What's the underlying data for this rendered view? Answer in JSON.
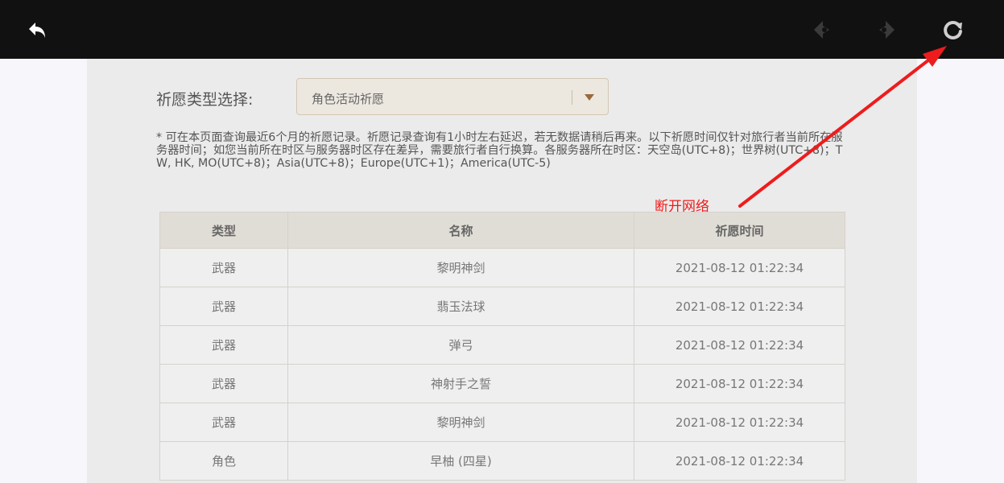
{
  "toolbar": {
    "icons": [
      "back-icon",
      "prev-page-icon",
      "next-page-icon",
      "refresh-icon"
    ]
  },
  "filter": {
    "label": "祈愿类型选择:",
    "selected": "角色活动祈愿"
  },
  "notice": "* 可在本页面查询最近6个月的祈愿记录。祈愿记录查询有1小时左右延迟，若无数据请稍后再来。以下祈愿时间仅针对旅行者当前所在服务器时间；如您当前所在时区与服务器时区存在差异，需要旅行者自行换算。各服务器所在时区：天空岛(UTC+8)；世界树(UTC+8)；TW, HK, MO(UTC+8)；Asia(UTC+8)；Europe(UTC+1)；America(UTC-5)",
  "annotation": {
    "text": "断开网络",
    "color": "#ee1c1c"
  },
  "table": {
    "headers": [
      "类型",
      "名称",
      "祈愿时间"
    ],
    "rows": [
      {
        "type": "武器",
        "name": "黎明神剑",
        "time": "2021-08-12 01:22:34"
      },
      {
        "type": "武器",
        "name": "翡玉法球",
        "time": "2021-08-12 01:22:34"
      },
      {
        "type": "武器",
        "name": "弹弓",
        "time": "2021-08-12 01:22:34"
      },
      {
        "type": "武器",
        "name": "神射手之誓",
        "time": "2021-08-12 01:22:34"
      },
      {
        "type": "武器",
        "name": "黎明神剑",
        "time": "2021-08-12 01:22:34"
      },
      {
        "type": "角色",
        "name": "早柚 (四星)",
        "time": "2021-08-12 01:22:34",
        "highlight": "#a256e1"
      }
    ]
  },
  "colors": {
    "topbar": "#111111",
    "panel": "#ebebeb",
    "four_star": "#a256e1",
    "arrow": "#ee1c1c"
  }
}
